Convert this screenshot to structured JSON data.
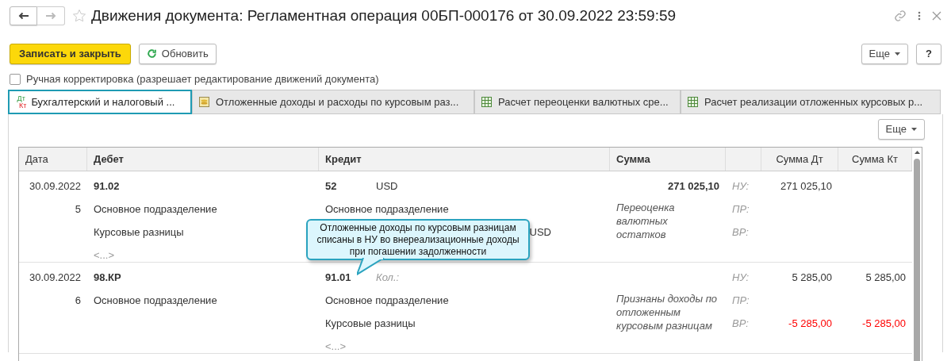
{
  "window": {
    "title": "Движения документа: Регламентная операция 00БП-000176 от 30.09.2022 23:59:59"
  },
  "toolbar": {
    "buttons": [
      {
        "label": "Записать и закрыть",
        "kind": "primary"
      },
      {
        "label": "Обновить",
        "kind": "refresh"
      }
    ],
    "more": "Еще",
    "help": "?"
  },
  "manual_edit": {
    "label": "Ручная корректировка (разрешает редактирование движений документа)",
    "checked": false
  },
  "tabs": [
    {
      "label": "Бухгалтерский и налоговый ...",
      "selected": true,
      "kind": "dtkt",
      "icon_top": "Дт",
      "icon_bottom": "Кт"
    },
    {
      "label": "Отложенные доходы и расходы по курсовым раз...",
      "selected": false,
      "kind": "coins"
    },
    {
      "label": "Расчет переоценки валютных сре...",
      "selected": false,
      "kind": "table"
    },
    {
      "label": "Расчет реализации отложенных курсовых р...",
      "selected": false,
      "kind": "table"
    }
  ],
  "table_more": "Еще",
  "table": {
    "columns": [
      "Дата",
      "Дебет",
      "Кредит",
      "Сумма",
      "Сумма Дт",
      "Сумма Кт"
    ],
    "rows": [
      {
        "date": "30.09.2022",
        "number": "5",
        "debit": {
          "account": "91.02",
          "lines": [
            {
              "text": "Основное подразделение",
              "kind": "plain"
            },
            {
              "text": "Курсовые разницы",
              "kind": "plain"
            },
            {
              "text": "<...>",
              "kind": "more"
            }
          ]
        },
        "credit": {
          "account": "52",
          "extra": "USD",
          "extra_muted": false,
          "lines": [
            {
              "text": "Основное подразделение",
              "kind": "plain"
            },
            {
              "text": "USD",
              "kind": "tail"
            }
          ]
        },
        "amount": "271 025,10",
        "description": "Переоценка валютных остатков",
        "ledgers": [
          {
            "label": "НУ:",
            "dt": {
              "text": "271 025,10",
              "negative": false
            }
          },
          {
            "label": "ПР:"
          },
          {
            "label": "ВР:"
          }
        ]
      },
      {
        "date": "30.09.2022",
        "number": "6",
        "debit": {
          "account": "98.КР",
          "lines": [
            {
              "text": "Основное подразделение",
              "kind": "plain"
            }
          ]
        },
        "credit": {
          "account": "91.01",
          "extra": "Кол.:",
          "extra_muted": true,
          "lines": [
            {
              "text": "Основное подразделение",
              "kind": "plain"
            },
            {
              "text": "Курсовые разницы",
              "kind": "plain"
            },
            {
              "text": "<...>",
              "kind": "more"
            }
          ]
        },
        "description": "Признаны доходы по отложенным курсовым разницам",
        "ledgers": [
          {
            "label": "НУ:",
            "dt": {
              "text": "5 285,00",
              "negative": false
            },
            "kt": {
              "text": "5 285,00",
              "negative": false
            }
          },
          {
            "label": "ПР:"
          },
          {
            "label": "ВР:",
            "dt": {
              "text": "-5 285,00",
              "negative": true
            },
            "kt": {
              "text": "-5 285,00",
              "negative": true
            }
          }
        ]
      }
    ]
  },
  "callout": {
    "text": "Отложенные доходы по курсовым разницам списаны в НУ во внереализационные доходы при погашении задолженности"
  }
}
